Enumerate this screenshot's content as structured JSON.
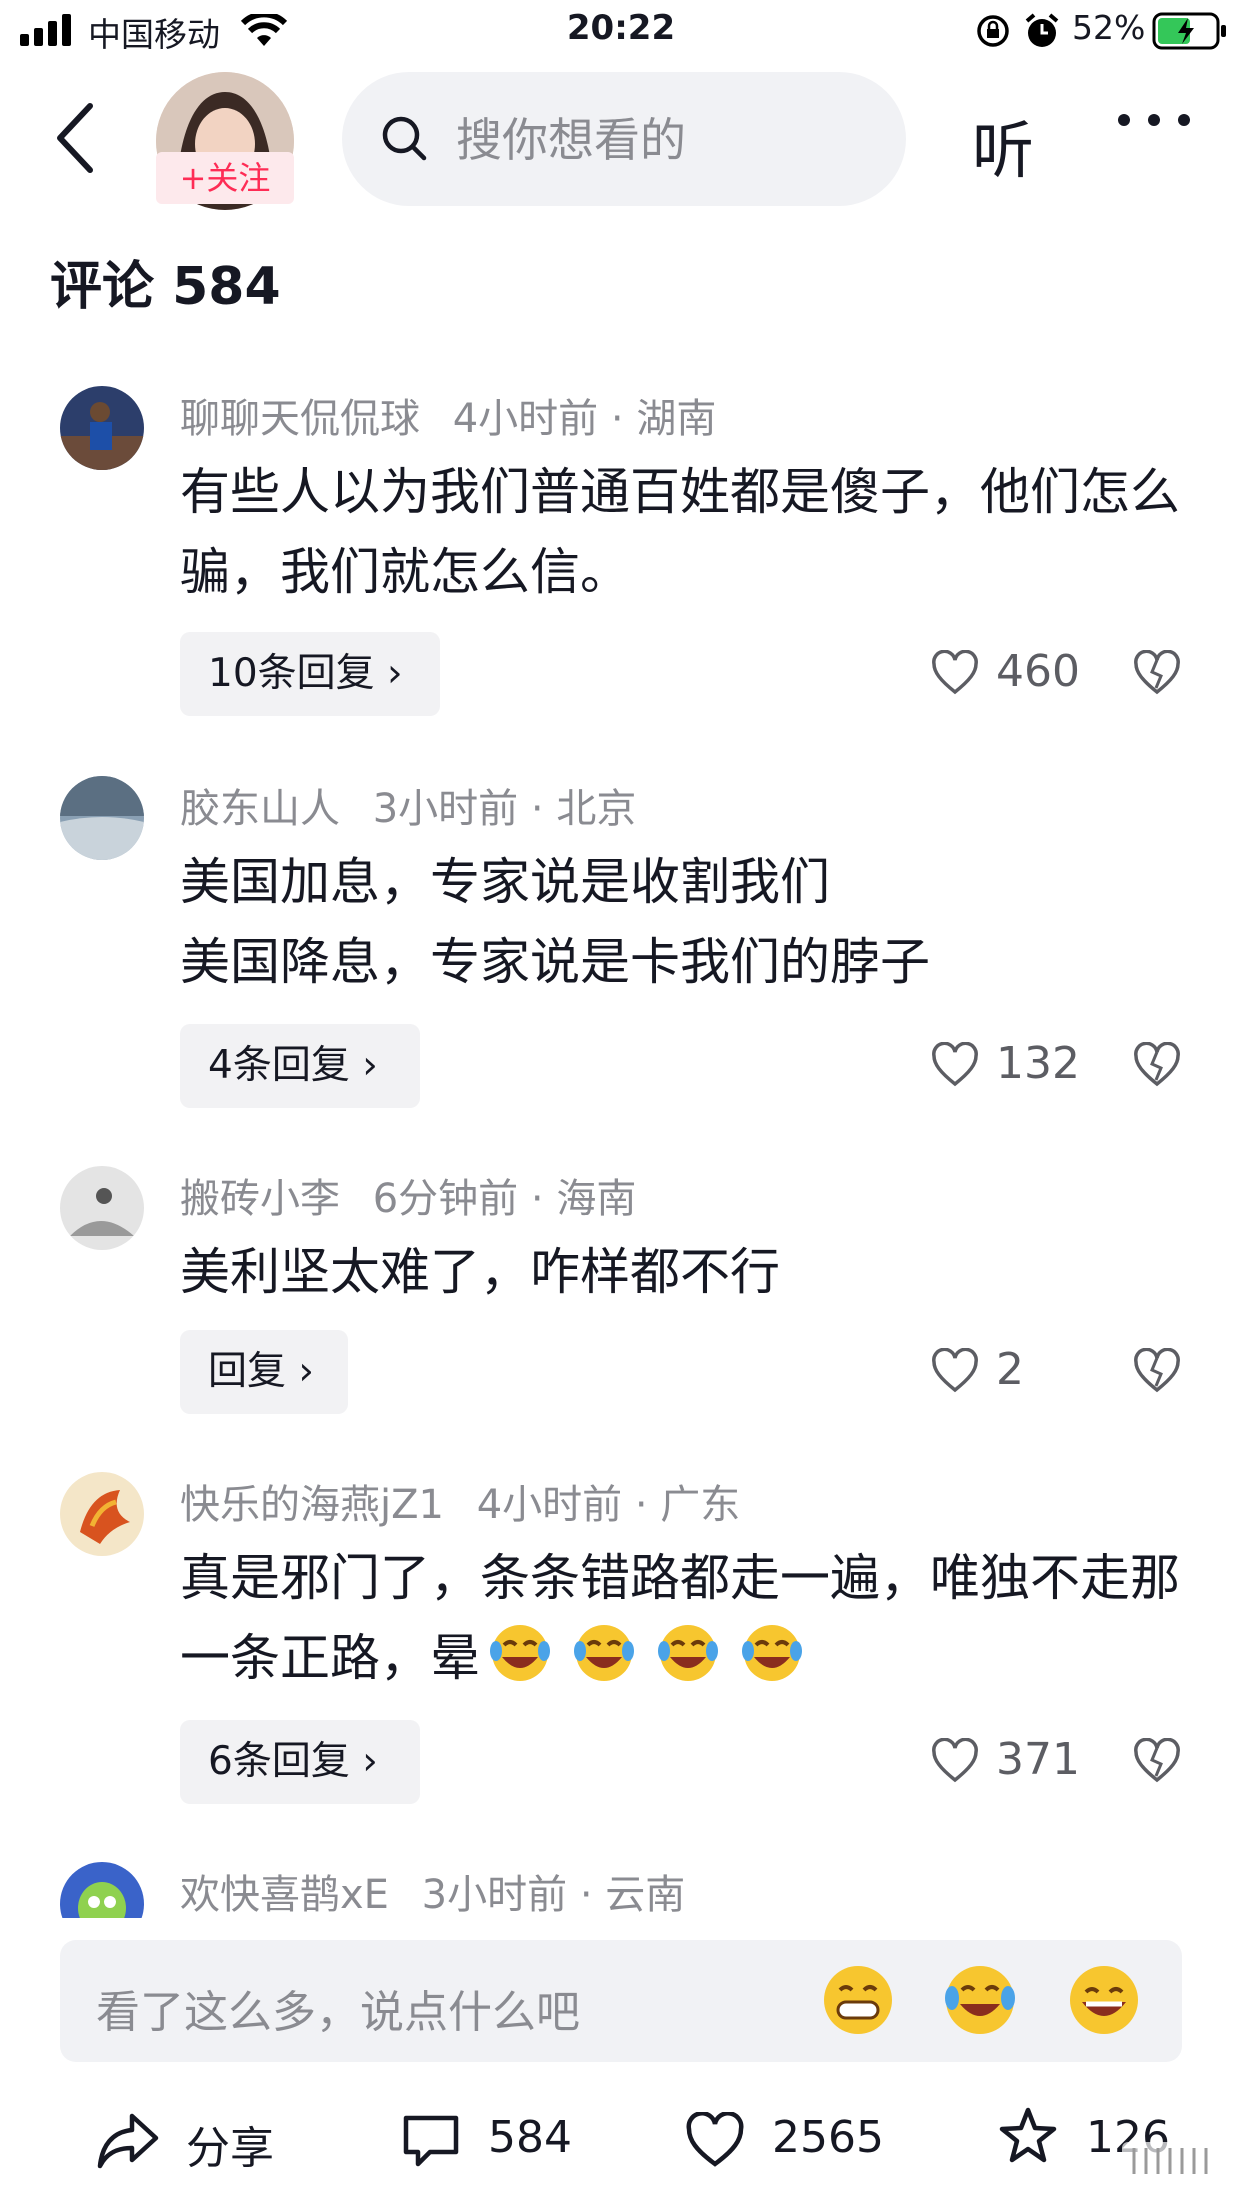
{
  "status_bar": {
    "carrier": "中国移动",
    "time": "20:22",
    "battery": "52%"
  },
  "header": {
    "follow_label": "+关注",
    "search_placeholder": "搜你想看的",
    "listen_label": "听"
  },
  "comments_title": "评论 584",
  "comments": [
    {
      "user": "聊聊天侃侃球",
      "time": "4小时前",
      "location": "湖南",
      "text": "有些人以为我们普通百姓都是傻子，他们怎么骗，我们就怎么信。",
      "reply_label": "10条回复",
      "likes": "460"
    },
    {
      "user": "胶东山人",
      "time": "3小时前",
      "location": "北京",
      "text_lines": [
        "美国加息，专家说是收割我们",
        "美国降息，专家说是卡我们的脖子"
      ],
      "reply_label": "4条回复",
      "likes": "132"
    },
    {
      "user": "搬砖小李",
      "time": "6分钟前",
      "location": "海南",
      "text": "美利坚太难了，咋样都不行",
      "reply_label": "回复",
      "likes": "2"
    },
    {
      "user": "快乐的海燕jZ1",
      "time": "4小时前",
      "location": "广东",
      "text": "真是邪门了，条条错路都走一遍，唯独不走那一条正路，晕",
      "emoji_count": 4,
      "emoji": "laughing-crying",
      "reply_label": "6条回复",
      "likes": "371"
    },
    {
      "user": "欢快喜鹊xE",
      "time": "3小时前",
      "location": "云南"
    }
  ],
  "input": {
    "placeholder": "看了这么多，说点什么吧",
    "emojis": [
      "grinning-emoji",
      "laughing-crying-emoji",
      "big-smile-emoji"
    ]
  },
  "bottom_bar": {
    "share_label": "分享",
    "comment_count": "584",
    "like_count": "2565",
    "favorite_count": "126"
  },
  "colors": {
    "accent": "#fe2c55",
    "text": "#161823",
    "secondary": "#8a8b91"
  }
}
